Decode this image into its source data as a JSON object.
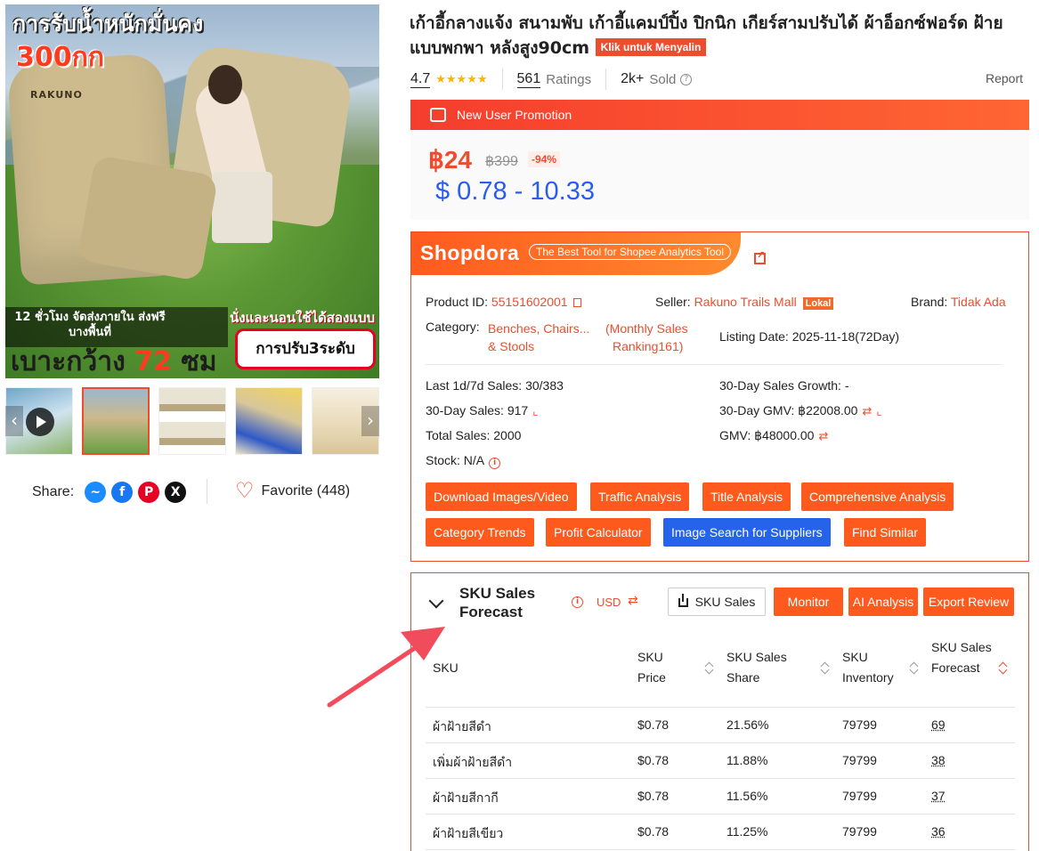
{
  "hero": {
    "headline": "การรับน้ำหนักมั่นคง",
    "weight": "300กก",
    "brand": "RAKUNO",
    "shipping": "12 ชั่วโมง จัดส่งภายใน ส่งฟรีบางพื้นที่",
    "width_prefix": "เบาะกว้าง",
    "width_value": "72",
    "width_unit": "ซม",
    "sit_sleep": "นั่งและนอนใช้ได้สองแบบ",
    "levels": "การปรับ3ระดับ"
  },
  "share": {
    "label": "Share:",
    "icons": [
      "messenger-icon",
      "facebook-icon",
      "pinterest-icon",
      "x-icon"
    ]
  },
  "favorite": {
    "label": "Favorite (448)"
  },
  "product": {
    "title": "เก้าอี้กลางแจ้ง สนามพับ เก้าอี้แคมป์ปิ้ง ปิกนิก เกียร์สามปรับได้ ผ้าอ็อกซ์ฟอร์ด ฝ้าย แบบพกพา หลังสูง90cm",
    "copy_label": "Klik untuk Menyalin",
    "rating": "4.7",
    "ratings_count": "561",
    "ratings_label": "Ratings",
    "sold_count": "2k+",
    "sold_label": "Sold",
    "report": "Report"
  },
  "promo": {
    "label": "New User Promotion",
    "price": "฿24",
    "old_price": "฿399",
    "discount": "-94%",
    "usd_range": "$ 0.78 - 10.33"
  },
  "shopdora": {
    "logo": "Shopdora",
    "tagline": "The Best Tool for Shopee Analytics Tool",
    "product_id_label": "Product ID:",
    "product_id": "55151602001",
    "seller_label": "Seller:",
    "seller": "Rakuno Trails Mall",
    "seller_badge": "Lokal",
    "brand_label": "Brand:",
    "brand": "Tidak Ada",
    "category_label": "Category:",
    "category_line1": "Benches, Chairs...",
    "category_line2": "& Stools",
    "ranking_line1": "(Monthly Sales",
    "ranking_line2": "Ranking161)",
    "listing_date": "Listing Date: 2025-11-18(72Day)",
    "last_sales": "Last 1d/7d Sales: 30/383",
    "growth": "30-Day Sales Growth: -",
    "sales_30": "30-Day Sales: 917",
    "gmv_30": "30-Day GMV: ฿22008.00",
    "total_sales": "Total Sales: 2000",
    "gmv": "GMV: ฿48000.00",
    "stock": "Stock: N/A",
    "buttons": [
      "Download Images/Video",
      "Traffic Analysis",
      "Title Analysis",
      "Comprehensive Analysis",
      "Category Trends",
      "Profit Calculator",
      "Image Search for Suppliers",
      "Find Similar"
    ]
  },
  "sku": {
    "title": "SKU Sales Forecast",
    "currency": "USD",
    "sku_sales_btn": "SKU Sales",
    "monitor_btn": "Monitor",
    "ai_btn": "AI Analysis",
    "export_btn": "Export Review",
    "columns": [
      "SKU",
      "SKU Price",
      "SKU Sales Share",
      "SKU Inventory",
      "SKU Sales Forecast"
    ],
    "rows": [
      {
        "name": "ผ้าฝ้ายสีดำ",
        "price": "$0.78",
        "share": "21.56%",
        "inventory": "79799",
        "forecast": "69"
      },
      {
        "name": "เพิ่มผ้าฝ้ายสีดำ",
        "price": "$0.78",
        "share": "11.88%",
        "inventory": "79799",
        "forecast": "38"
      },
      {
        "name": "ผ้าฝ้ายสีกากี",
        "price": "$0.78",
        "share": "11.56%",
        "inventory": "79799",
        "forecast": "37"
      },
      {
        "name": "ผ้าฝ้ายสีเขียว",
        "price": "$0.78",
        "share": "11.25%",
        "inventory": "79799",
        "forecast": "36"
      }
    ]
  },
  "colors": {
    "accent": "#ee4d2d",
    "usd_blue": "#2b5cf0",
    "button_blue": "#2563eb"
  }
}
